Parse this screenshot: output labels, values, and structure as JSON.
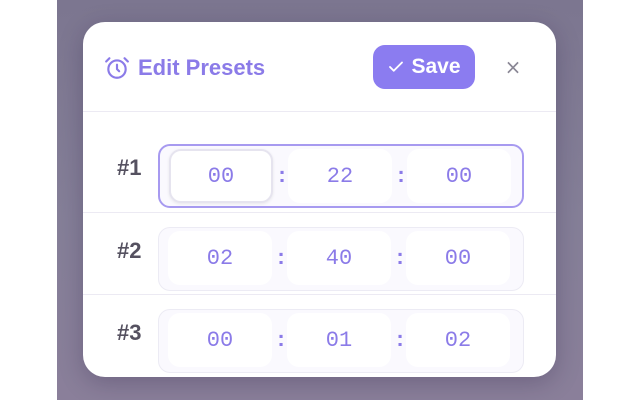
{
  "dialog": {
    "title": "Edit Presets",
    "title_icon": "alarm-clock-icon",
    "save_label": "Save",
    "save_icon": "check-icon",
    "close_label": "×"
  },
  "presets": [
    {
      "label": "#1",
      "hours": "00",
      "minutes": "22",
      "seconds": "00",
      "active": true
    },
    {
      "label": "#2",
      "hours": "02",
      "minutes": "40",
      "seconds": "00",
      "active": false
    },
    {
      "label": "#3",
      "hours": "00",
      "minutes": "01",
      "seconds": "02",
      "active": false
    }
  ],
  "separator": ":",
  "colors": {
    "accent": "#8b7cf0",
    "accent_text": "#8b7be8",
    "label_text": "#555160"
  }
}
